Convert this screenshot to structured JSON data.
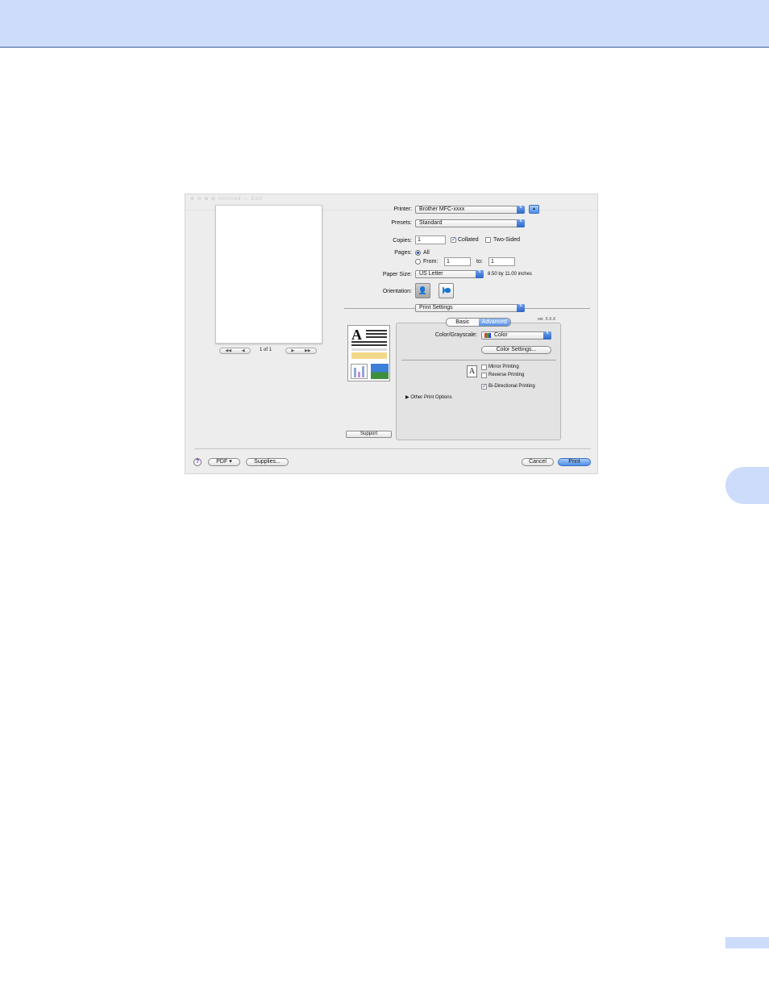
{
  "dialog": {
    "ghost_title": "⊗ ⊖ ⊕ ⊞    Untitled — Edit",
    "preview": {
      "page_counter": "1 of 1",
      "first": "◀◀",
      "prev": "◀",
      "next": "▶",
      "last": "▶▶"
    },
    "printer": {
      "label": "Printer:",
      "value": "Brother MFC-xxxx",
      "expand": "▲"
    },
    "presets": {
      "label": "Presets:",
      "value": "Standard"
    },
    "copies": {
      "label": "Copies:",
      "value": "1",
      "collated_label": "Collated",
      "collated_checked": "✓",
      "two_sided_label": "Two-Sided"
    },
    "pages": {
      "label": "Pages:",
      "all_label": "All",
      "from_label": "From:",
      "from_value": "1",
      "to_label": "to:",
      "to_value": "1"
    },
    "paper_size": {
      "label": "Paper Size:",
      "value": "US Letter",
      "dimensions": "8.50 by 11.00 inches"
    },
    "orientation": {
      "label": "Orientation:",
      "portrait_icon": "person-portrait-icon",
      "landscape_icon": "person-landscape-icon"
    },
    "section_popup": {
      "value": "Print Settings"
    },
    "tabs": [
      {
        "label": "Basic"
      },
      {
        "label": "Advanced"
      }
    ],
    "version": "ver. X.X.X",
    "color_grayscale": {
      "label": "Color/Grayscale:",
      "value": "Color"
    },
    "color_settings_button": "Color Settings...",
    "mirror_printing": "Mirror Printing",
    "reverse_printing": "Reverse Printing",
    "bidirectional": {
      "label": "Bi-Directional Printing",
      "checked": "✓"
    },
    "other_print_options": "Other Print Options",
    "support_button": "Support",
    "footer": {
      "help": "?",
      "pdf": "PDF ▾",
      "supplies": "Supplies...",
      "cancel": "Cancel",
      "print": "Print"
    }
  }
}
